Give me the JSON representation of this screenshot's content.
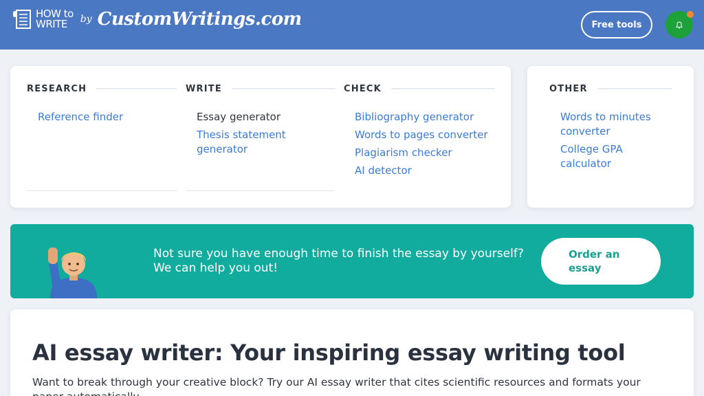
{
  "header": {
    "logo_line1": "HOW to",
    "logo_line2": "WRITE",
    "logo_by": "by",
    "logo_brand": "CustomWritings.com",
    "free_tools_label": "Free tools",
    "bell_icon": "bell-icon",
    "colors": {
      "bar": "#4a78c2",
      "avatar": "#1ea03b",
      "notification": "#f0883a"
    }
  },
  "tools": {
    "research": {
      "heading": "RESEARCH",
      "links": [
        "Reference finder"
      ]
    },
    "write": {
      "heading": "WRITE",
      "links": [
        "Essay generator",
        "Thesis statement generator"
      ]
    },
    "check": {
      "heading": "CHECK",
      "links": [
        "Bibliography generator",
        "Words to pages converter",
        "Plagiarism checker",
        "AI detector"
      ]
    },
    "other": {
      "heading": "OTHER",
      "links": [
        "Words to minutes converter",
        "College GPA calculator"
      ]
    }
  },
  "banner": {
    "text": "Not sure you have enough time to finish the essay by yourself? We can help you out!",
    "button_label": "Order an essay",
    "color": "#12ac9f"
  },
  "article": {
    "title": "AI essay writer: Your inspiring essay writing tool",
    "intro": "Want to break through your creative block? Try our AI essay writer that cites scientific resources and formats your paper automatically."
  }
}
